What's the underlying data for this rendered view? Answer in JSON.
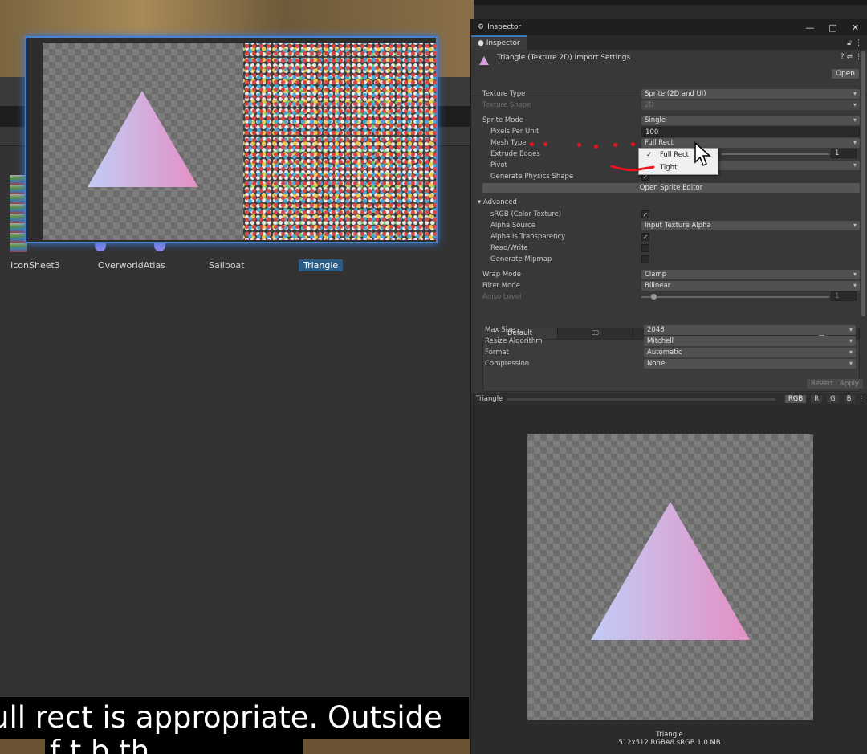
{
  "inspector": {
    "window_title": "Inspector",
    "tab_label": "Inspector",
    "header_title": "Triangle (Texture 2D) Import Settings",
    "open_label": "Open",
    "texture_type_label": "Texture Type",
    "texture_type_value": "Sprite (2D and UI)",
    "texture_shape_label": "Texture Shape",
    "texture_shape_value": "2D",
    "sprite_mode_label": "Sprite Mode",
    "sprite_mode_value": "Single",
    "ppu_label": "Pixels Per Unit",
    "ppu_value": "100",
    "mesh_type_label": "Mesh Type",
    "mesh_type_value": "Full Rect",
    "extrude_label": "Extrude Edges",
    "extrude_value": "1",
    "pivot_label": "Pivot",
    "physics_label": "Generate Physics Shape",
    "sprite_editor_label": "Open Sprite Editor",
    "advanced_label": "Advanced",
    "srgb_label": "sRGB (Color Texture)",
    "alpha_source_label": "Alpha Source",
    "alpha_source_value": "Input Texture Alpha",
    "alpha_transparency_label": "Alpha Is Transparency",
    "read_write_label": "Read/Write",
    "mipmap_label": "Generate Mipmap",
    "wrap_label": "Wrap Mode",
    "wrap_value": "Clamp",
    "filter_label": "Filter Mode",
    "filter_value": "Bilinear",
    "aniso_label": "Aniso Level",
    "aniso_value": "1",
    "platform_default": "Default",
    "max_size_label": "Max Size",
    "max_size_value": "2048",
    "resize_label": "Resize Algorithm",
    "resize_value": "Mitchell",
    "format_label": "Format",
    "format_value": "Automatic",
    "compression_label": "Compression",
    "compression_value": "None",
    "revert_label": "Revert",
    "apply_label": "Apply",
    "check_mark": "✓"
  },
  "dropdown": {
    "items": [
      "Full Rect",
      "Tight"
    ],
    "selected_mark": "✓"
  },
  "preview": {
    "title": "Triangle",
    "channels": [
      "RGB",
      "R",
      "G",
      "B"
    ],
    "name": "Triangle",
    "info": "512x512  RGBA8 sRGB   1.0 MB"
  },
  "assets": {
    "labels": [
      "IconSheet3",
      "OverworldAtlas",
      "Sailboat",
      "Triangle"
    ]
  },
  "caption": {
    "line1": "ull rect is appropriate. Outside",
    "line2": "f     t   b th"
  },
  "colors": {
    "accent": "#3b78dc",
    "annotation": "#e8141e",
    "triangle_left": "#c2ccf6",
    "triangle_right": "#e490c4"
  }
}
